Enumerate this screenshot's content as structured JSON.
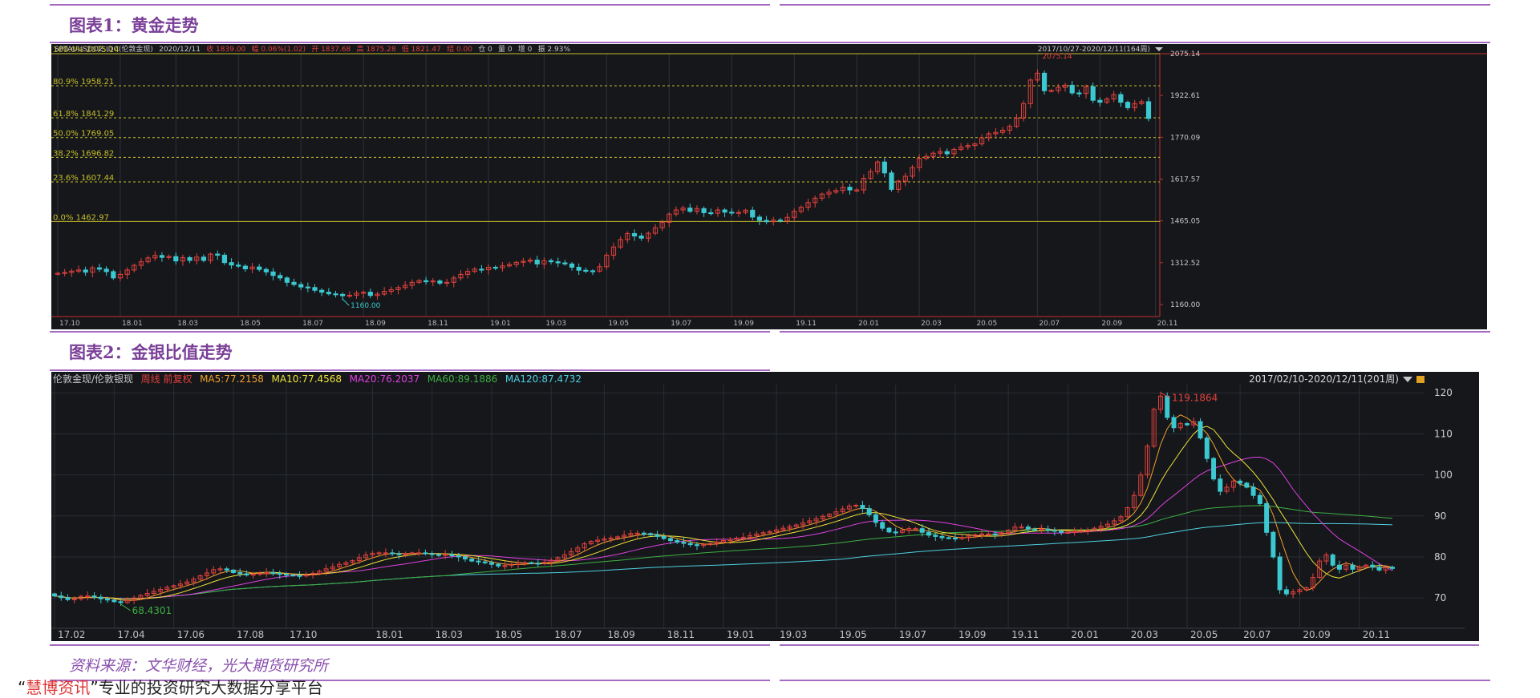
{
  "page": {
    "title1": "图表1：黄金走势",
    "title2": "图表2：金银比值走势",
    "source": "资料来源：文华财经，光大期货研究所",
    "footer_quote_open": "“",
    "footer_brand": "慧博资讯",
    "footer_quote_close": "”",
    "footer_text": "专业的投资研究大数据分享平台"
  },
  "colors": {
    "up": "#e3413d",
    "down": "#3cc8d0",
    "fib_line": "#c8bd2a",
    "ma5": "#f2a02a",
    "ma10": "#f0e23a",
    "ma20": "#e040e0",
    "ma60": "#3fb043",
    "ma120": "#4fd0e0",
    "heading": "#7a3f98"
  },
  "chart_data": [
    {
      "type": "candlestick",
      "title": "SPTAUUSDOZ.IDC(伦敦金现)",
      "header": [
        {
          "label": "",
          "value": "SPTAUUSDOZ.IDC(伦敦金现)",
          "color": "#c8c8c8"
        },
        {
          "label": "",
          "value": "2020/12/11",
          "color": "#c8c8c8"
        },
        {
          "label": "收 ",
          "value": "1839.00",
          "color": "#e3413d"
        },
        {
          "label": "幅 ",
          "value": "0.06%(1.02)",
          "color": "#e3413d"
        },
        {
          "label": "开 ",
          "value": "1837.68",
          "color": "#e3413d"
        },
        {
          "label": "高 ",
          "value": "1875.28",
          "color": "#e3413d"
        },
        {
          "label": "低 ",
          "value": "1821.47",
          "color": "#e3413d"
        },
        {
          "label": "结 ",
          "value": "0.00",
          "color": "#e3413d"
        },
        {
          "label": "仓 ",
          "value": "0",
          "color": "#c8c8c8"
        },
        {
          "label": "量 ",
          "value": "0",
          "color": "#c8c8c8"
        },
        {
          "label": "增 ",
          "value": "0",
          "color": "#c8c8c8"
        },
        {
          "label": "振 ",
          "value": "2.93%",
          "color": "#c8c8c8"
        }
      ],
      "range_label": "2017/10/27-2020/12/11(164周)",
      "ylim": [
        1160.0,
        2075.14
      ],
      "y_ticks": [
        "2075.14",
        "1922.61",
        "1770.09",
        "1617.57",
        "1465.05",
        "1312.52",
        "1160.00"
      ],
      "y_tick_values": [
        2075.14,
        1922.61,
        1770.09,
        1617.57,
        1465.05,
        1312.52,
        1160.0
      ],
      "x_ticks": [
        "17.10",
        "18.01",
        "18.03",
        "18.05",
        "18.07",
        "18.09",
        "18.11",
        "19.01",
        "19.03",
        "19.05",
        "19.07",
        "19.09",
        "19.11",
        "20.01",
        "20.03",
        "20.05",
        "20.07",
        "20.09",
        "20.11"
      ],
      "x_tick_index": [
        0,
        9,
        17,
        26,
        35,
        44,
        53,
        62,
        70,
        79,
        88,
        97,
        106,
        115,
        124,
        132,
        141,
        150,
        158
      ],
      "fib_levels": [
        {
          "label": "100.0%",
          "value": 2075.14,
          "solid": true
        },
        {
          "label": "80.9%",
          "value": 1958.21,
          "solid": false
        },
        {
          "label": "61.8%",
          "value": 1841.29,
          "solid": false
        },
        {
          "label": "50.0%",
          "value": 1769.05,
          "solid": false
        },
        {
          "label": "38.2%",
          "value": 1696.82,
          "solid": false
        },
        {
          "label": "23.6%",
          "value": 1607.44,
          "solid": false
        },
        {
          "label": "0.0%",
          "value": 1462.97,
          "solid": true
        }
      ],
      "annotations": [
        {
          "label": "2075.14",
          "at": "max"
        },
        {
          "label": "1160.00",
          "at": "min"
        }
      ],
      "series": [
        {
          "name": "伦敦金现",
          "close": [
            1274,
            1277,
            1282,
            1286,
            1278,
            1294,
            1289,
            1280,
            1257,
            1270,
            1286,
            1303,
            1316,
            1330,
            1339,
            1332,
            1335,
            1319,
            1331,
            1321,
            1333,
            1321,
            1344,
            1340,
            1313,
            1304,
            1300,
            1290,
            1297,
            1288,
            1279,
            1266,
            1257,
            1241,
            1233,
            1224,
            1222,
            1212,
            1205,
            1199,
            1197,
            1192,
            1194,
            1201,
            1205,
            1193,
            1198,
            1208,
            1214,
            1222,
            1230,
            1241,
            1247,
            1243,
            1246,
            1238,
            1241,
            1257,
            1270,
            1281,
            1289,
            1287,
            1296,
            1294,
            1301,
            1306,
            1314,
            1318,
            1322,
            1308,
            1320,
            1316,
            1312,
            1308,
            1296,
            1285,
            1283,
            1282,
            1298,
            1340,
            1370,
            1397,
            1419,
            1410,
            1402,
            1420,
            1440,
            1460,
            1490,
            1505,
            1512,
            1500,
            1510,
            1495,
            1493,
            1505,
            1497,
            1494,
            1496,
            1504,
            1479,
            1467,
            1462,
            1468,
            1465,
            1478,
            1500,
            1515,
            1532,
            1548,
            1563,
            1570,
            1576,
            1588,
            1578,
            1578,
            1620,
            1645,
            1680,
            1640,
            1580,
            1610,
            1628,
            1660,
            1693,
            1700,
            1712,
            1718,
            1710,
            1726,
            1735,
            1740,
            1746,
            1768,
            1783,
            1788,
            1796,
            1810,
            1840,
            1893,
            1979,
            2004,
            1940,
            1941,
            1952,
            1960,
            1932,
            1930,
            1955,
            1905,
            1898,
            1910,
            1926,
            1898,
            1878,
            1893,
            1900,
            1839
          ]
        }
      ]
    },
    {
      "type": "line",
      "title": "伦敦金现/伦敦银现",
      "header": [
        {
          "label": "",
          "value": "伦敦金现/伦敦银现",
          "color": "#c8c8c8"
        },
        {
          "label": "",
          "value": "周线 前复权",
          "color": "#e3413d"
        },
        {
          "label": "MA5:",
          "value": "77.2158",
          "color": "#f2a02a"
        },
        {
          "label": "MA10:",
          "value": "77.4568",
          "color": "#f0e23a"
        },
        {
          "label": "MA20:",
          "value": "76.2037",
          "color": "#e040e0"
        },
        {
          "label": "MA60:",
          "value": "89.1886",
          "color": "#3fb043"
        },
        {
          "label": "MA120:",
          "value": "87.4732",
          "color": "#4fd0e0"
        }
      ],
      "range_label": "2017/02/10-2020/12/11(201周)",
      "ylim": [
        63,
        122
      ],
      "y_ticks": [
        "120",
        "110",
        "100",
        "90",
        "80",
        "70"
      ],
      "y_tick_values": [
        120,
        110,
        100,
        90,
        80,
        70
      ],
      "x_ticks": [
        "17.02",
        "17.04",
        "17.06",
        "17.08",
        "17.10",
        "18.01",
        "18.03",
        "18.05",
        "18.07",
        "18.09",
        "18.11",
        "19.01",
        "19.03",
        "19.05",
        "19.07",
        "19.09",
        "19.11",
        "20.01",
        "20.03",
        "20.05",
        "20.07",
        "20.09",
        "20.11"
      ],
      "x_tick_index": [
        0,
        9,
        18,
        27,
        35,
        48,
        57,
        66,
        75,
        83,
        92,
        101,
        109,
        118,
        127,
        136,
        144,
        153,
        162,
        171,
        179,
        188,
        197
      ],
      "annotations": [
        {
          "label": "119.1864",
          "at": "max"
        },
        {
          "label": "68.4301",
          "at": "min"
        }
      ],
      "series": [
        {
          "name": "金银比",
          "close": [
            70.5,
            70.1,
            69.6,
            69.8,
            70.4,
            70.5,
            70.2,
            69.8,
            69.5,
            69.1,
            68.9,
            69.4,
            70.0,
            70.6,
            71.1,
            71.6,
            72.1,
            72.6,
            73.0,
            73.4,
            73.9,
            74.6,
            75.4,
            76.1,
            76.9,
            77.1,
            76.8,
            76.2,
            75.9,
            75.6,
            75.8,
            76.1,
            76.2,
            76.0,
            75.8,
            75.6,
            75.5,
            75.4,
            75.6,
            76.0,
            76.5,
            77.1,
            77.6,
            78.2,
            78.6,
            79.1,
            79.8,
            80.5,
            80.9,
            81.0,
            81.0,
            80.8,
            80.6,
            80.8,
            81.0,
            81.0,
            80.8,
            80.6,
            80.5,
            80.6,
            80.3,
            80.0,
            79.5,
            79.0,
            78.8,
            78.6,
            78.2,
            77.8,
            77.9,
            78.2,
            78.6,
            78.6,
            78.5,
            78.4,
            78.7,
            79.2,
            79.8,
            80.5,
            81.3,
            82.2,
            83.2,
            83.8,
            84.1,
            84.4,
            84.6,
            84.9,
            85.3,
            85.7,
            85.8,
            85.7,
            85.4,
            85.0,
            84.5,
            84.0,
            83.6,
            83.3,
            83.0,
            82.8,
            83.0,
            83.3,
            83.6,
            84.0,
            84.3,
            84.6,
            84.8,
            85.2,
            85.6,
            85.9,
            86.2,
            86.6,
            87.0,
            87.4,
            87.8,
            88.3,
            88.8,
            89.3,
            89.9,
            90.4,
            91.0,
            91.7,
            92.4,
            92.6,
            91.8,
            90.3,
            88.4,
            87.0,
            86.1,
            86.0,
            86.5,
            86.9,
            86.9,
            86.0,
            85.3,
            85.0,
            84.7,
            84.6,
            84.5,
            84.7,
            85.1,
            85.4,
            85.6,
            85.6,
            85.5,
            85.9,
            86.5,
            87.3,
            87.3,
            86.8,
            86.7,
            86.8,
            86.5,
            86.3,
            86.0,
            86.0,
            86.2,
            86.3,
            86.6,
            87.0,
            87.5,
            88.0,
            88.8,
            89.8,
            92.0,
            95.0,
            100.0,
            107.0,
            116.0,
            119.2,
            114.0,
            111.5,
            112.5,
            112.2,
            113.0,
            109.0,
            104.0,
            99.0,
            96.0,
            97.0,
            98.5,
            98.0,
            97.0,
            95.0,
            93.0,
            86.0,
            80.0,
            72.0,
            71.0,
            71.5,
            72.0,
            72.5,
            75.0,
            79.0,
            80.5,
            78.0,
            77.0,
            78.0,
            77.0,
            77.5,
            78.0,
            77.5,
            76.8,
            77.5,
            77.2
          ]
        }
      ]
    }
  ]
}
